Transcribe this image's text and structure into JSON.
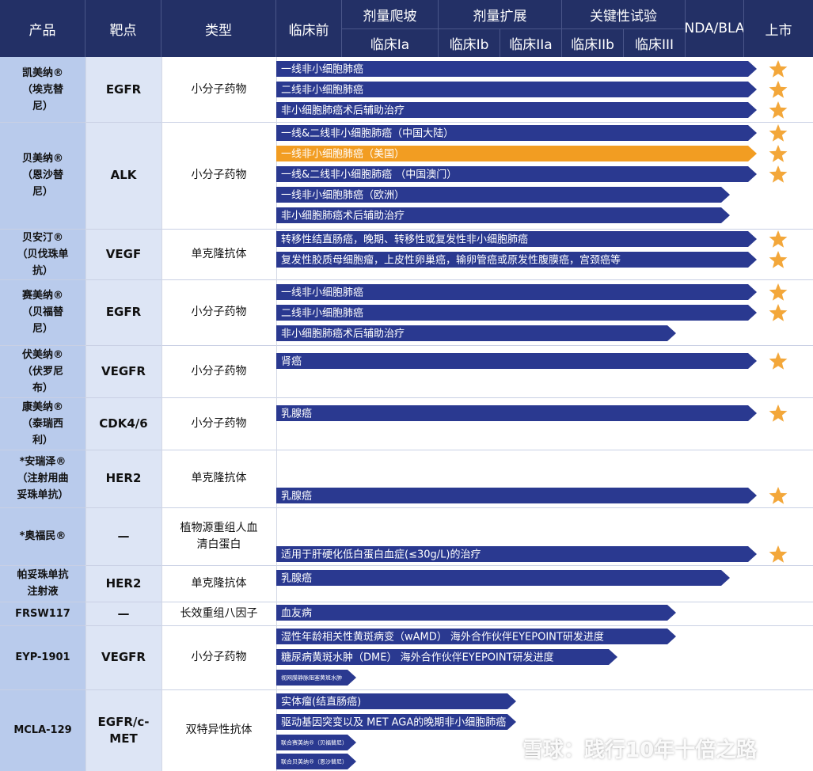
{
  "header": {
    "product": "产品",
    "target": "靶点",
    "type": "类型",
    "preclinical": "临床前",
    "dose_escalation": "剂量爬坡",
    "dose_expansion": "剂量扩展",
    "pivotal": "关键性试验",
    "nda_bla": "NDA/BLA",
    "launch": "上市",
    "phase_1a": "临床Ia",
    "phase_1b": "临床Ib",
    "phase_2a": "临床IIa",
    "phase_2b": "临床IIb",
    "phase_3": "临床III"
  },
  "colors": {
    "header_bg": "#233066",
    "bar_blue": "#2a3990",
    "bar_orange": "#f29d22",
    "star": "#f3a73a",
    "product_col": "#b9cbec",
    "target_col": "#dde5f5"
  },
  "rows": [
    {
      "product": "凯美纳®\n（埃克替\n尼）",
      "target": "EGFR",
      "type": "小分子药物"
    },
    {
      "product": "贝美纳®\n（恩沙替\n尼）",
      "target": "ALK",
      "type": "小分子药物"
    },
    {
      "product": "贝安汀®\n（贝伐珠单\n抗）",
      "target": "VEGF",
      "type": "单克隆抗体"
    },
    {
      "product": "赛美纳®\n（贝福替\n尼）",
      "target": "EGFR",
      "type": "小分子药物"
    },
    {
      "product": "伏美纳®\n（伏罗尼\n布）",
      "target": "VEGFR",
      "type": "小分子药物"
    },
    {
      "product": "康美纳®\n（泰瑞西\n利）",
      "target": "CDK4/6",
      "type": "小分子药物"
    },
    {
      "product": "*安瑞泽®\n（注射用曲\n妥珠单抗）",
      "target": "HER2",
      "type": "单克隆抗体"
    },
    {
      "product": "*奥福民®",
      "target": "—",
      "type": "植物源重组人血\n清白蛋白"
    },
    {
      "product": "帕妥珠单抗\n注射液",
      "target": "HER2",
      "type": "单克隆抗体"
    },
    {
      "product": "FRSW117",
      "target": "—",
      "type": "长效重组八因子"
    },
    {
      "product": "EYP-1901",
      "target": "VEGFR",
      "type": "小分子药物"
    },
    {
      "product": "MCLA-129",
      "target": "EGFR/c-MET",
      "type": "双特异性抗体"
    }
  ],
  "chart_data": {
    "type": "bar",
    "stages": [
      "临床前",
      "临床Ia",
      "临床Ib",
      "临床IIa",
      "临床IIb",
      "临床III",
      "NDA/BLA",
      "上市"
    ],
    "bars": [
      {
        "row": 0,
        "label": "一线非小细胞肺癌",
        "stage": "上市",
        "color": "blue",
        "star": true
      },
      {
        "row": 0,
        "label": "二线非小细胞肺癌",
        "stage": "上市",
        "color": "blue",
        "star": true
      },
      {
        "row": 0,
        "label": "非小细胞肺癌术后辅助治疗",
        "stage": "上市",
        "color": "blue",
        "star": true
      },
      {
        "row": 1,
        "label": "一线&二线非小细胞肺癌（中国大陆）",
        "stage": "上市",
        "color": "blue",
        "star": true
      },
      {
        "row": 1,
        "label": "一线非小细胞肺癌（美国）",
        "stage": "上市",
        "color": "orange",
        "star": true
      },
      {
        "row": 1,
        "label": "一线&二线非小细胞肺癌 （中国澳门）",
        "stage": "上市",
        "color": "blue",
        "star": true
      },
      {
        "row": 1,
        "label": "一线非小细胞肺癌（欧洲）",
        "stage": "NDA/BLA",
        "color": "blue",
        "star": false
      },
      {
        "row": 1,
        "label": "非小细胞肺癌术后辅助治疗",
        "stage": "NDA/BLA",
        "color": "blue",
        "star": false
      },
      {
        "row": 2,
        "label": "转移性结直肠癌，晚期、转移性或复发性非小细胞肺癌",
        "stage": "上市",
        "color": "blue",
        "star": true
      },
      {
        "row": 2,
        "label": "复发性胶质母细胞瘤，上皮性卵巢癌，输卵管癌或原发性腹膜癌，宫颈癌等",
        "stage": "上市",
        "color": "blue",
        "star": true
      },
      {
        "row": 3,
        "label": "一线非小细胞肺癌",
        "stage": "上市",
        "color": "blue",
        "star": true
      },
      {
        "row": 3,
        "label": "二线非小细胞肺癌",
        "stage": "上市",
        "color": "blue",
        "star": true
      },
      {
        "row": 3,
        "label": "非小细胞肺癌术后辅助治疗",
        "stage": "临床III",
        "color": "blue",
        "star": false
      },
      {
        "row": 4,
        "label": "肾癌",
        "stage": "上市",
        "color": "blue",
        "star": true
      },
      {
        "row": 5,
        "label": "乳腺癌",
        "stage": "上市",
        "color": "blue",
        "star": true
      },
      {
        "row": 6,
        "label": "乳腺癌",
        "stage": "上市",
        "color": "blue",
        "star": true
      },
      {
        "row": 7,
        "label": "适用于肝硬化低白蛋白血症(≤30g/L)的治疗",
        "stage": "上市",
        "color": "blue",
        "star": true
      },
      {
        "row": 8,
        "label": "乳腺癌",
        "stage": "NDA/BLA",
        "color": "blue",
        "star": false
      },
      {
        "row": 9,
        "label": "血友病",
        "stage": "临床III",
        "color": "blue",
        "star": false
      },
      {
        "row": 10,
        "label": "湿性年龄相关性黄斑病变（wAMD） 海外合作伙伴EYEPOINT研发进度",
        "stage": "临床III",
        "color": "blue",
        "star": false
      },
      {
        "row": 10,
        "label": "糖尿病黄斑水肿（DME） 海外合作伙伴EYEPOINT研发进度",
        "stage": "临床IIb",
        "color": "blue",
        "star": false
      },
      {
        "row": 10,
        "label": "视网膜静脉阻塞黄斑水肿",
        "stage": "临床Ia",
        "color": "blue",
        "star": false
      },
      {
        "row": 11,
        "label": "实体瘤(结直肠癌)",
        "stage": "临床Ib",
        "color": "blue",
        "star": false
      },
      {
        "row": 11,
        "label": "驱动基因突变以及 MET AGA的晚期非小细胞肺癌",
        "stage": "临床Ib",
        "color": "blue",
        "star": false
      },
      {
        "row": 11,
        "label": "联合赛美纳®（贝福替尼）",
        "stage": "临床Ia",
        "color": "blue",
        "star": false
      },
      {
        "row": 11,
        "label": "联合贝美纳®（恩沙替尼）",
        "stage": "临床Ia",
        "color": "blue",
        "star": false
      }
    ]
  },
  "watermark": {
    "text": "雪球：践行10年十倍之路"
  }
}
